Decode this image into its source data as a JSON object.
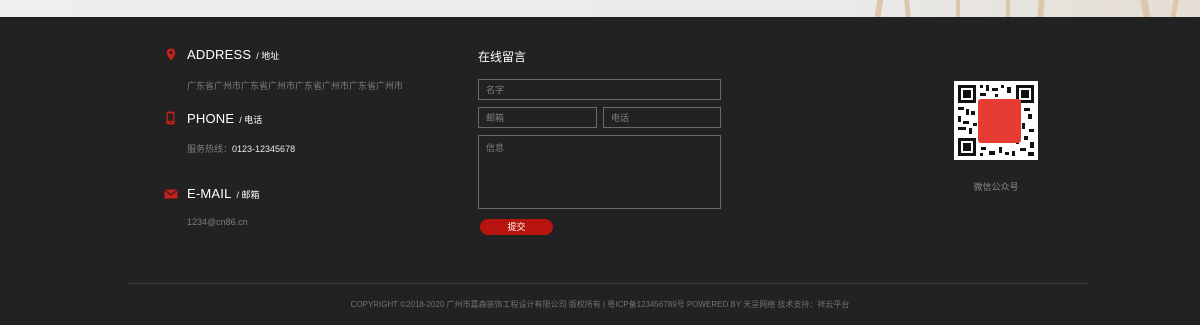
{
  "contact": {
    "address": {
      "label": "ADDRESS",
      "sub": "/ 地址",
      "value": "广东省广州市广东省广州市广东省广州市广东省广州市"
    },
    "phone": {
      "label": "PHONE",
      "sub": "/ 电话",
      "value_prefix": "服务热线：",
      "value": "0123-12345678"
    },
    "email": {
      "label": "E-MAIL",
      "sub": "/ 邮箱",
      "value": "1234@cn86.cn"
    }
  },
  "form": {
    "title": "在线留言",
    "name_placeholder": "名字",
    "email_placeholder": "邮箱",
    "phone_placeholder": "电话",
    "message_placeholder": "信息",
    "submit_label": "提交"
  },
  "qr": {
    "label": "微信公众号"
  },
  "footer": {
    "copyright": "COPYRIGHT ©2018-2020 广州市嘉森装饰工程设计有限公司 版权所有 | 粤ICP备123456789号 POWERED BY 天呈网络 技术支持：祥云平台"
  },
  "colors": {
    "background": "#222222",
    "accent": "#b8140f",
    "qr_center": "#e53c34"
  },
  "icons": [
    "location-pin-icon",
    "mobile-phone-icon",
    "envelope-icon"
  ]
}
